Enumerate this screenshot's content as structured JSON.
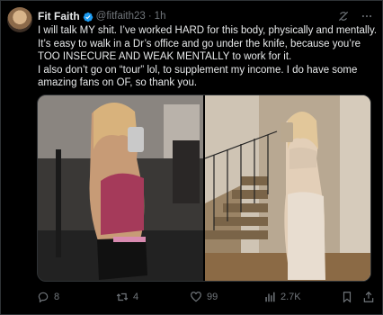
{
  "author": {
    "name": "Fit Faith",
    "handle": "@fitfaith23",
    "separator": "·",
    "time": "1h"
  },
  "tweet": {
    "lines": [
      "I will talk MY shit. I’ve worked HARD for this body, physically and mentally.",
      "It’s easy to walk in a Dr’s office and go under the knife, because you’re TOO INSECURE AND WEAK MENTALLY to work for it.",
      "I also don’t go on “tour” lol, to supplement my income. I do have some amazing fans on OF, so thank you."
    ]
  },
  "actions": {
    "replies": "8",
    "reposts": "4",
    "likes": "99",
    "views": "2.7K"
  },
  "colors": {
    "background": "#000000",
    "text": "#e7e9ea",
    "muted": "#71767b",
    "verified": "#1d9bf0",
    "border": "#2f3336"
  },
  "icons": {
    "verified": "verified-badge-icon",
    "grok": "grok-icon",
    "more": "more-icon",
    "reply": "reply-icon",
    "repost": "repost-icon",
    "like": "like-icon",
    "views": "views-icon",
    "bookmark": "bookmark-icon",
    "share": "share-icon"
  }
}
